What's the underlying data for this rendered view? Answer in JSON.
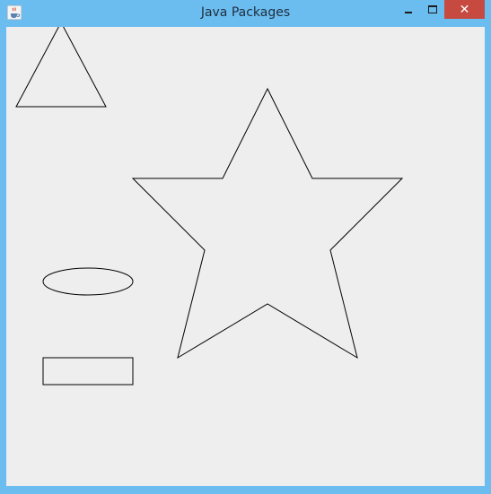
{
  "window": {
    "title": "Java Packages",
    "close_glyph": "✕",
    "icons": {
      "app": "java-cup-icon",
      "minimize": "minimize-icon",
      "maximize": "maximize-icon",
      "close": "close-icon"
    },
    "colors": {
      "frame": "#6bbdf0",
      "client_background": "#eeeeee",
      "close_button": "#c74a41",
      "shape_stroke": "#000000"
    }
  },
  "canvas": {
    "shapes": [
      {
        "kind": "triangle",
        "name": "triangle-shape"
      },
      {
        "kind": "star",
        "name": "star-shape"
      },
      {
        "kind": "ellipse",
        "name": "ellipse-shape"
      },
      {
        "kind": "rectangle",
        "name": "rectangle-shape"
      }
    ]
  }
}
